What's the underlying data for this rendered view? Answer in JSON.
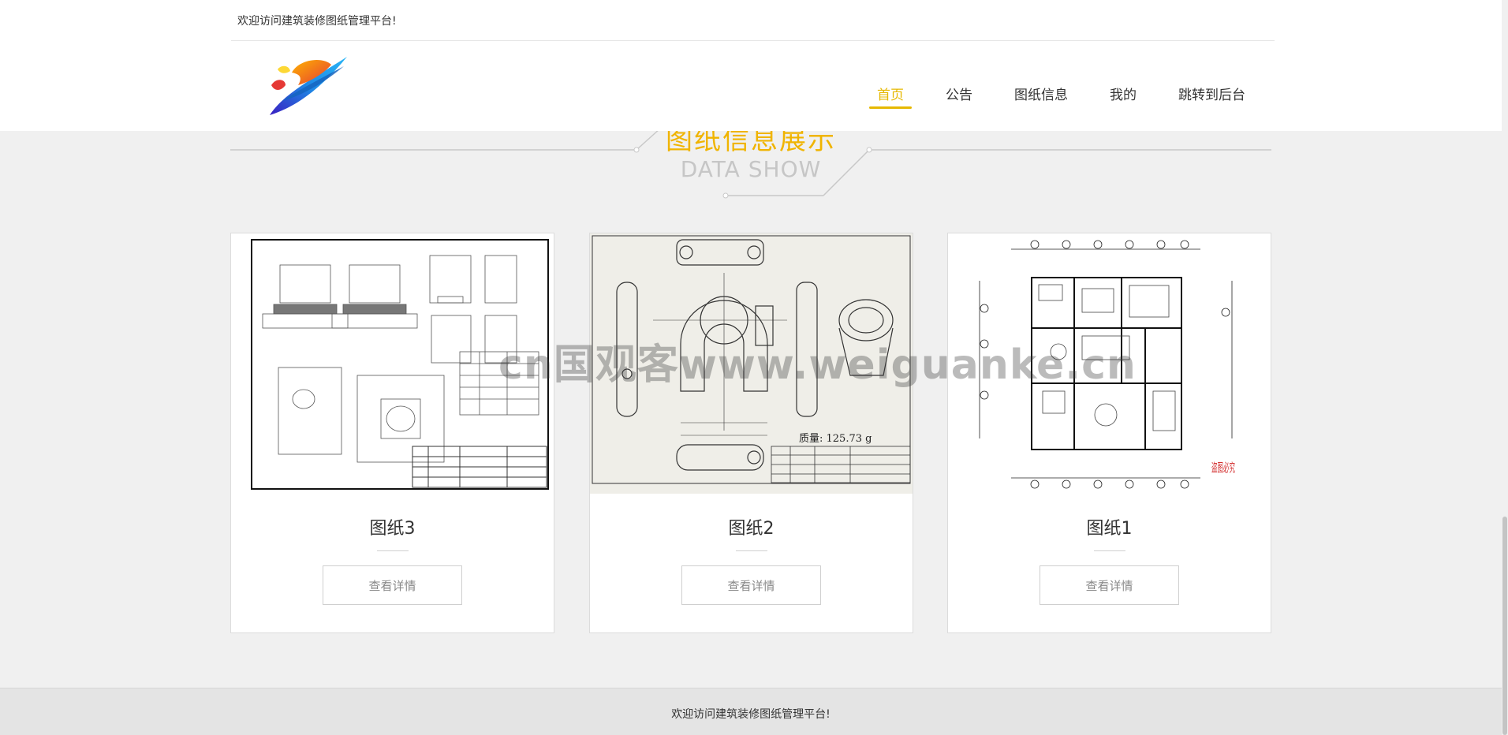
{
  "header": {
    "welcome": "欢迎访问建筑装修图纸管理平台!",
    "nav": [
      {
        "label": "首页",
        "active": true
      },
      {
        "label": "公告",
        "active": false
      },
      {
        "label": "图纸信息",
        "active": false
      },
      {
        "label": "我的",
        "active": false
      },
      {
        "label": "跳转到后台",
        "active": false
      }
    ],
    "logo_icon": "brand-swoosh-logo",
    "accent_color": "#e6b800"
  },
  "section": {
    "title_cn": "图纸信息展示",
    "title_en": "DATA SHOW"
  },
  "cards": [
    {
      "title": "图纸3",
      "button": "查看详情",
      "image_icon": "engineering-drawing-foundation"
    },
    {
      "title": "图纸2",
      "button": "查看详情",
      "image_icon": "mechanical-part-drawing",
      "drawing_mass": "质量: 125.73 g"
    },
    {
      "title": "图纸1",
      "button": "查看详情",
      "image_icon": "floor-plan-drawing",
      "stamp_text": "盗图必究"
    }
  ],
  "watermark": "cn国观客www.weiguanke.cn",
  "footer": {
    "text": "欢迎访问建筑装修图纸管理平台!"
  }
}
